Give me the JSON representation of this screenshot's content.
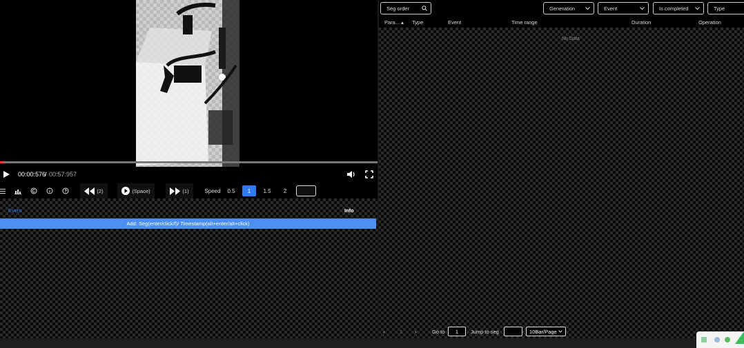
{
  "video": {
    "current_time": "00:00:576",
    "separator": " / ",
    "total_time": "00:57:957",
    "progress_fraction": 0.01
  },
  "toolbar": {
    "rewind_label": "(2)",
    "play_label": "(Space)",
    "forward_label": "(1)",
    "speed_label": "Speed",
    "speeds": [
      "0.5",
      "1",
      "1.5",
      "2"
    ],
    "active_speed": "1",
    "speed_input": ""
  },
  "events": {
    "col_event": "Event",
    "col_info": "Info",
    "row_text": "Add: Seg(enter/click/f)/ Timestamp(alt+enter/alt+click)"
  },
  "filters": {
    "seg_order": "Seg order",
    "generation": "Generation",
    "event": "Event",
    "is_completed": "Is completed",
    "type": "Type"
  },
  "table": {
    "columns": [
      "Para...",
      "Type",
      "Event",
      "Time range",
      "Duration",
      "Operation"
    ],
    "empty_text": "No Data"
  },
  "pager": {
    "page": "1",
    "goto_label": "Go to",
    "goto_value": "1",
    "jump_label": "Jump to seg",
    "jump_value": "",
    "page_size": "10Bar/Page"
  },
  "colors": {
    "accent": "#2f7bf0",
    "row_highlight": "#4a90f0"
  }
}
